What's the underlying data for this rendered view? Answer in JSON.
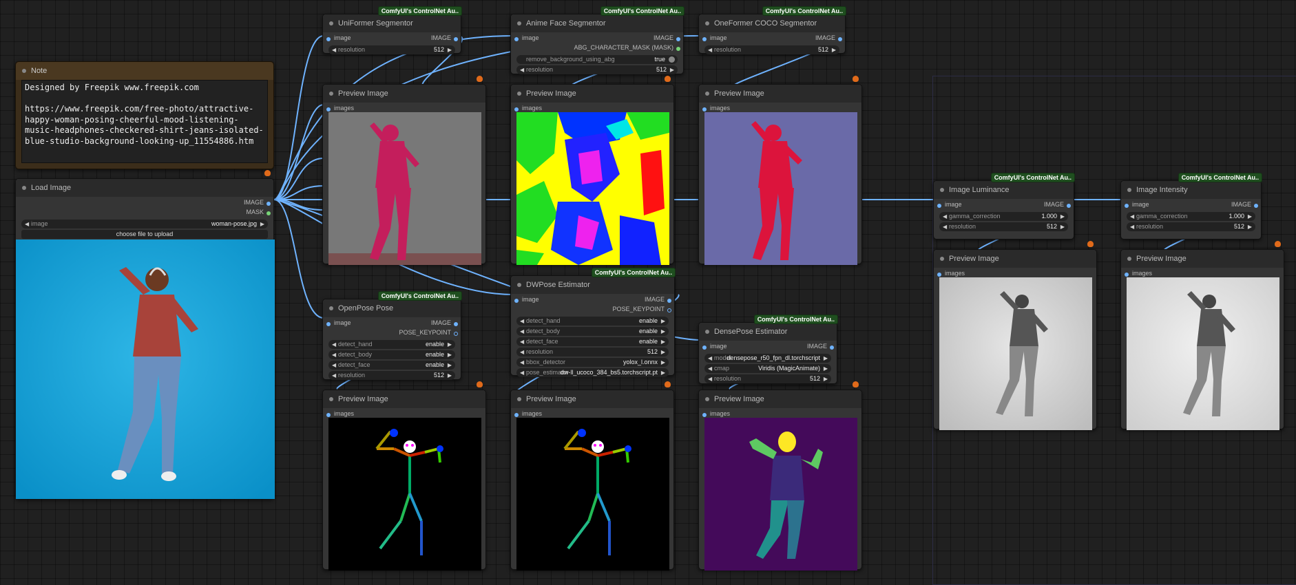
{
  "badge": "ComfyUI's ControlNet Au..",
  "note": {
    "title": "Note",
    "text": "Designed by Freepik www.freepik.com\n\nhttps://www.freepik.com/free-photo/attractive-happy-woman-posing-cheerful-mood-listening-music-headphones-checkered-shirt-jeans-isolated-blue-studio-background-looking-up_11554886.htm"
  },
  "load_image": {
    "title": "Load Image",
    "out1": "IMAGE",
    "out2": "MASK",
    "image_label": "image",
    "image_value": "woman-pose.jpg",
    "upload_label": "choose file to upload"
  },
  "uniformer": {
    "title": "UniFormer Segmentor",
    "in": "image",
    "out": "IMAGE",
    "res_label": "resolution",
    "res_value": "512"
  },
  "anime": {
    "title": "Anime Face Segmentor",
    "in": "image",
    "out": "IMAGE",
    "out2": "ABG_CHARACTER_MASK (MASK)",
    "rb_label": "remove_background_using_abg",
    "rb_value": "true",
    "res_label": "resolution",
    "res_value": "512"
  },
  "oneformer": {
    "title": "OneFormer COCO Segmentor",
    "in": "image",
    "out": "IMAGE",
    "res_label": "resolution",
    "res_value": "512"
  },
  "preview": {
    "title": "Preview Image",
    "in": "images"
  },
  "openpose": {
    "title": "OpenPose Pose",
    "in": "image",
    "out": "IMAGE",
    "out2": "POSE_KEYPOINT",
    "widgets": [
      {
        "label": "detect_hand",
        "value": "enable"
      },
      {
        "label": "detect_body",
        "value": "enable"
      },
      {
        "label": "detect_face",
        "value": "enable"
      },
      {
        "label": "resolution",
        "value": "512"
      }
    ]
  },
  "dwpose": {
    "title": "DWPose Estimator",
    "in": "image",
    "out": "IMAGE",
    "out2": "POSE_KEYPOINT",
    "widgets": [
      {
        "label": "detect_hand",
        "value": "enable"
      },
      {
        "label": "detect_body",
        "value": "enable"
      },
      {
        "label": "detect_face",
        "value": "enable"
      },
      {
        "label": "resolution",
        "value": "512"
      },
      {
        "label": "bbox_detector",
        "value": "yolox_l.onnx"
      },
      {
        "label": "pose_estimator",
        "value": "dw-ll_ucoco_384_bs5.torchscript.pt"
      }
    ]
  },
  "densepose": {
    "title": "DensePose Estimator",
    "in": "image",
    "out": "IMAGE",
    "widgets": [
      {
        "label": "model",
        "value": "densepose_r50_fpn_dl.torchscript"
      },
      {
        "label": "cmap",
        "value": "Viridis (MagicAnimate)"
      },
      {
        "label": "resolution",
        "value": "512"
      }
    ]
  },
  "luminance": {
    "title": "Image Luminance",
    "in": "image",
    "out": "IMAGE",
    "widgets": [
      {
        "label": "gamma_correction",
        "value": "1.000"
      },
      {
        "label": "resolution",
        "value": "512"
      }
    ]
  },
  "intensity": {
    "title": "Image Intensity",
    "in": "image",
    "out": "IMAGE",
    "widgets": [
      {
        "label": "gamma_correction",
        "value": "1.000"
      },
      {
        "label": "resolution",
        "value": "512"
      }
    ]
  },
  "colors": {
    "wire": "#6fb3ff",
    "badge": "#1f4f1f",
    "accent": "#e06a1a"
  }
}
